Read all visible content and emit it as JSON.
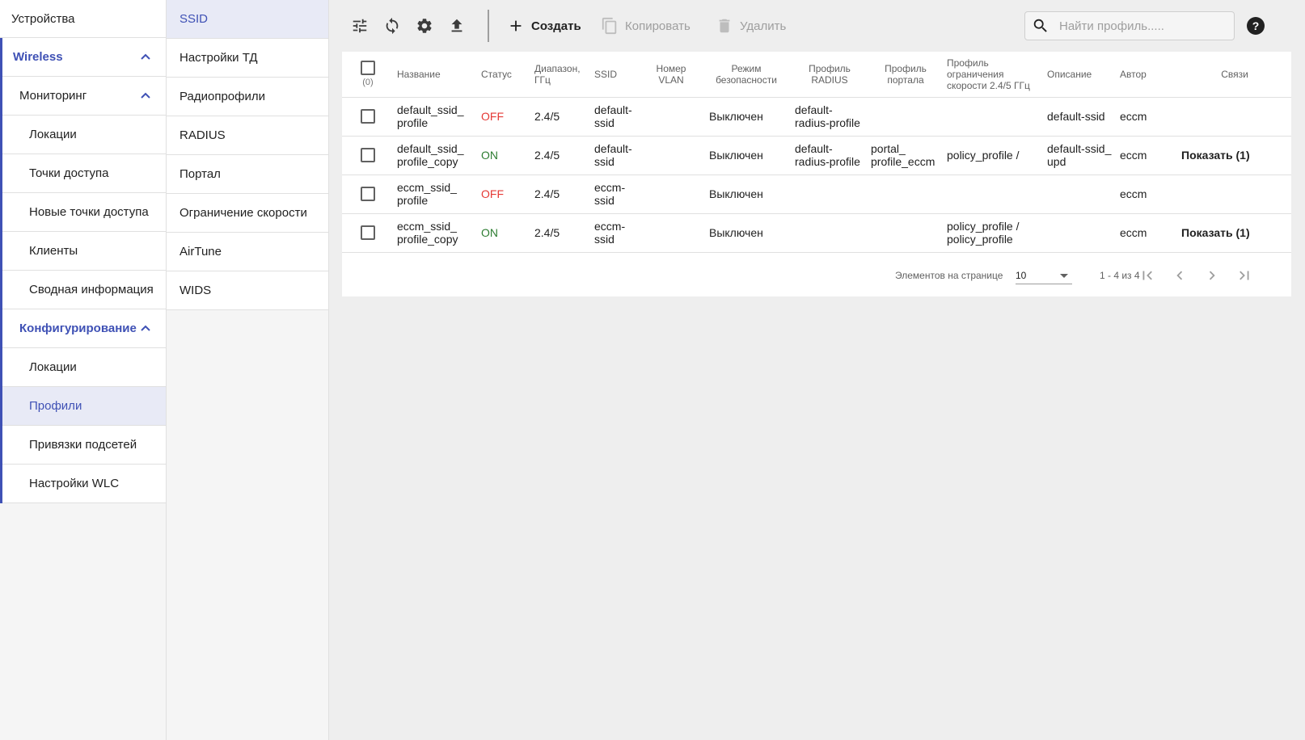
{
  "nav": {
    "top": "Устройства",
    "items": [
      {
        "label": "Wireless",
        "level": 0,
        "accent": true,
        "expanded": true
      },
      {
        "label": "Мониторинг",
        "level": 1,
        "expanded": true
      },
      {
        "label": "Локации",
        "level": 2
      },
      {
        "label": "Точки доступа",
        "level": 2
      },
      {
        "label": "Новые точки доступа",
        "level": 2
      },
      {
        "label": "Клиенты",
        "level": 2
      },
      {
        "label": "Сводная информация",
        "level": 2
      },
      {
        "label": "Конфигурирование",
        "level": 1,
        "accent": true,
        "expanded": true
      },
      {
        "label": "Локации",
        "level": 2
      },
      {
        "label": "Профили",
        "level": 2,
        "selected": true
      },
      {
        "label": "Привязки подсетей",
        "level": 2
      },
      {
        "label": "Настройки WLC",
        "level": 2
      }
    ]
  },
  "subnav": {
    "items": [
      {
        "label": "SSID",
        "selected": true
      },
      {
        "label": "Настройки ТД"
      },
      {
        "label": "Радиопрофили"
      },
      {
        "label": "RADIUS"
      },
      {
        "label": "Портал"
      },
      {
        "label": "Ограничение скорости"
      },
      {
        "label": "AirTune"
      },
      {
        "label": "WIDS"
      }
    ]
  },
  "toolbar": {
    "create_label": "Создать",
    "copy_label": "Копировать",
    "delete_label": "Удалить",
    "search_placeholder": "Найти профиль....."
  },
  "table": {
    "selected_count": "(0)",
    "columns": {
      "name": "Название",
      "status": "Статус",
      "band": "Диапазон, ГГц",
      "ssid": "SSID",
      "vlan": "Номер VLAN",
      "security": "Режим безопасности",
      "radius": "Профиль RADIUS",
      "portal": "Профиль портала",
      "rate": "Профиль ограничения скорости 2.4/5 ГГц",
      "description": "Описание",
      "author": "Автор",
      "links": "Связи"
    },
    "rows": [
      {
        "name": "default_ssid_ profile",
        "status": "OFF",
        "band": "2.4/5",
        "ssid": "default- ssid",
        "vlan": "",
        "security": "Выключен",
        "radius": "default- radius-profile",
        "portal": "",
        "rate": "",
        "description": "default-ssid",
        "author": "eccm",
        "links": ""
      },
      {
        "name": "default_ssid_ profile_copy",
        "status": "ON",
        "band": "2.4/5",
        "ssid": "default- ssid",
        "vlan": "",
        "security": "Выключен",
        "radius": "default- radius-profile",
        "portal": "portal_ profile_eccm",
        "rate": "policy_profile /",
        "description": "default-ssid_ upd",
        "author": "eccm",
        "links": "Показать (1)"
      },
      {
        "name": "eccm_ssid_ profile",
        "status": "OFF",
        "band": "2.4/5",
        "ssid": "eccm- ssid",
        "vlan": "",
        "security": "Выключен",
        "radius": "",
        "portal": "",
        "rate": "",
        "description": "",
        "author": "eccm",
        "links": ""
      },
      {
        "name": "eccm_ssid_ profile_copy",
        "status": "ON",
        "band": "2.4/5",
        "ssid": "eccm- ssid",
        "vlan": "",
        "security": "Выключен",
        "radius": "",
        "portal": "",
        "rate": "policy_profile / policy_profile",
        "description": "",
        "author": "eccm",
        "links": "Показать (1)"
      }
    ]
  },
  "paginator": {
    "label": "Элементов на странице",
    "page_size": "10",
    "range": "1 - 4 из 4"
  },
  "colors": {
    "accent": "#3f51b5",
    "status_on": "#2e7d32",
    "status_off": "#e53935",
    "selected_bg": "#e8eaf6"
  }
}
